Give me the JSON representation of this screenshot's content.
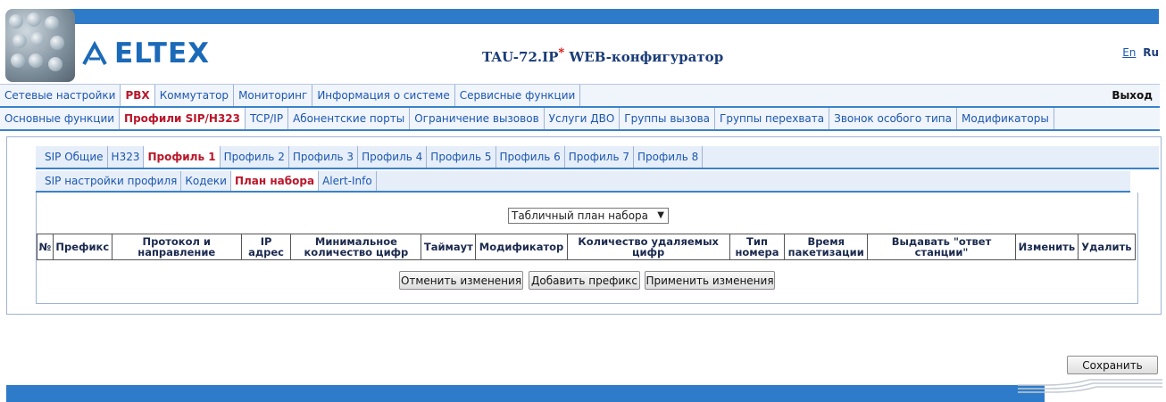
{
  "header": {
    "brand": "ELTEX",
    "title_main": "TAU-72.IP",
    "title_mark": "*",
    "title_rest": " WEB-конфигуратор",
    "lang_en": "En",
    "lang_ru": "Ru"
  },
  "menu_main": {
    "items": [
      "Сетевые настройки",
      "PBX",
      "Коммутатор",
      "Мониторинг",
      "Информация о системе",
      "Сервисные функции"
    ],
    "active": "PBX",
    "logout": "Выход"
  },
  "menu_pbx": {
    "items": [
      "Основные функции",
      "Профили SIP/H323",
      "TCP/IP",
      "Абонентские порты",
      "Ограничение вызовов",
      "Услуги ДВО",
      "Группы вызова",
      "Группы перехвата",
      "Звонок особого типа",
      "Модификаторы"
    ],
    "active": "Профили SIP/H323"
  },
  "profile_tabs": {
    "items": [
      "SIP Общие",
      "H323",
      "Профиль 1",
      "Профиль 2",
      "Профиль 3",
      "Профиль 4",
      "Профиль 5",
      "Профиль 6",
      "Профиль 7",
      "Профиль 8"
    ],
    "active": "Профиль 1"
  },
  "profile_subtabs": {
    "items": [
      "SIP настройки профиля",
      "Кодеки",
      "План набора",
      "Alert-Info"
    ],
    "active": "План набора"
  },
  "dialplan": {
    "type_selected": "Табличный план набора",
    "columns": [
      "№",
      "Префикс",
      "Протокол и направление",
      "IP адрес",
      "Минимальное количество цифр",
      "Таймаут",
      "Модификатор",
      "Количество удаляемых цифр",
      "Тип номера",
      "Время пакетизации",
      "Выдавать \"ответ станции\"",
      "Изменить",
      "Удалить"
    ]
  },
  "buttons": {
    "cancel": "Отменить изменения",
    "add_prefix": "Добавить префикс",
    "apply": "Применить изменения",
    "save": "Сохранить"
  },
  "colors": {
    "accent_blue": "#2e7bc9",
    "active_tab": "#b8172a",
    "link": "#1b57b0"
  }
}
